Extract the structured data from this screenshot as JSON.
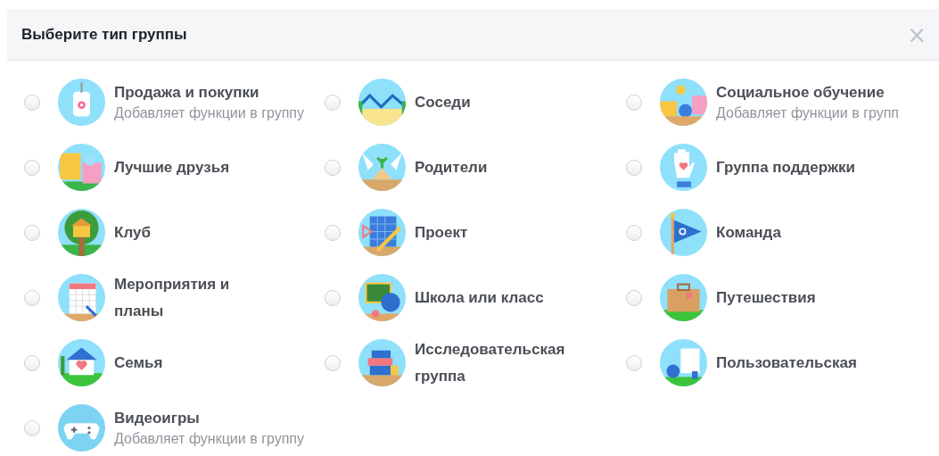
{
  "dialog": {
    "title": "Выберите тип группы",
    "close": "×"
  },
  "group_types": [
    {
      "label": "Продажа и покупки",
      "subtitle": "Добавляет функции в группу",
      "selected": false
    },
    {
      "label": "Соседи",
      "selected": false
    },
    {
      "label": "Социальное обучение",
      "subtitle": "Добавляет функции в групп",
      "selected": false
    },
    {
      "label": "Лучшие друзья",
      "selected": false
    },
    {
      "label": "Родители",
      "selected": false
    },
    {
      "label": "Группа поддержки",
      "selected": false
    },
    {
      "label": "Клуб",
      "selected": false
    },
    {
      "label": "Проект",
      "selected": false
    },
    {
      "label": "Команда",
      "selected": false
    },
    {
      "label": "Мероприятия и планы",
      "selected": false
    },
    {
      "label": "Школа или класс",
      "selected": false
    },
    {
      "label": "Путешествия",
      "selected": false
    },
    {
      "label": "Семья",
      "selected": false
    },
    {
      "label": "Исследовательская группа",
      "selected": false
    },
    {
      "label": "Пользовательская",
      "selected": false
    },
    {
      "label": "Видеоигры",
      "subtitle": "Добавляет функции в группу",
      "selected": false
    }
  ]
}
